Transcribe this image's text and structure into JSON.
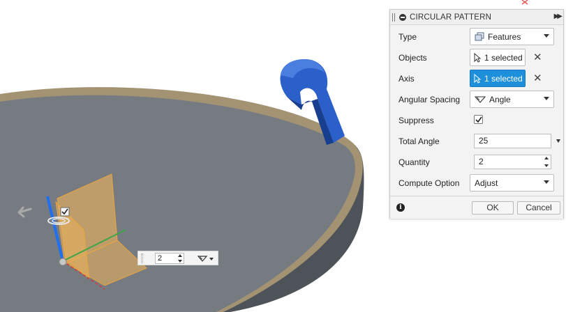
{
  "dialog": {
    "title": "CIRCULAR PATTERN",
    "rows": {
      "type": {
        "label": "Type",
        "value": "Features",
        "icon": "features-icon"
      },
      "objects": {
        "label": "Objects",
        "value": "1 selected",
        "icon": "cursor-arrow-icon"
      },
      "axis": {
        "label": "Axis",
        "value": "1 selected",
        "icon": "cursor-arrow-icon",
        "active": true
      },
      "angular_spacing": {
        "label": "Angular Spacing",
        "value": "Angle",
        "icon": "angle-icon"
      },
      "suppress": {
        "label": "Suppress",
        "checked": true
      },
      "total_angle": {
        "label": "Total Angle",
        "value": "25"
      },
      "quantity": {
        "label": "Quantity",
        "value": "2"
      },
      "compute_option": {
        "label": "Compute Option",
        "value": "Adjust"
      }
    },
    "buttons": {
      "ok": "OK",
      "cancel": "Cancel"
    }
  },
  "canvas": {
    "mini_toolbar": {
      "quantity": "2"
    },
    "manipulator_checkbox": true
  },
  "colors": {
    "accent_selected": "#1e8fdb",
    "model_blue": "#2b5fc9",
    "plate_top": "#7a7f86",
    "plate_rim": "#a49373",
    "preview_orange": "#f0b45a"
  }
}
